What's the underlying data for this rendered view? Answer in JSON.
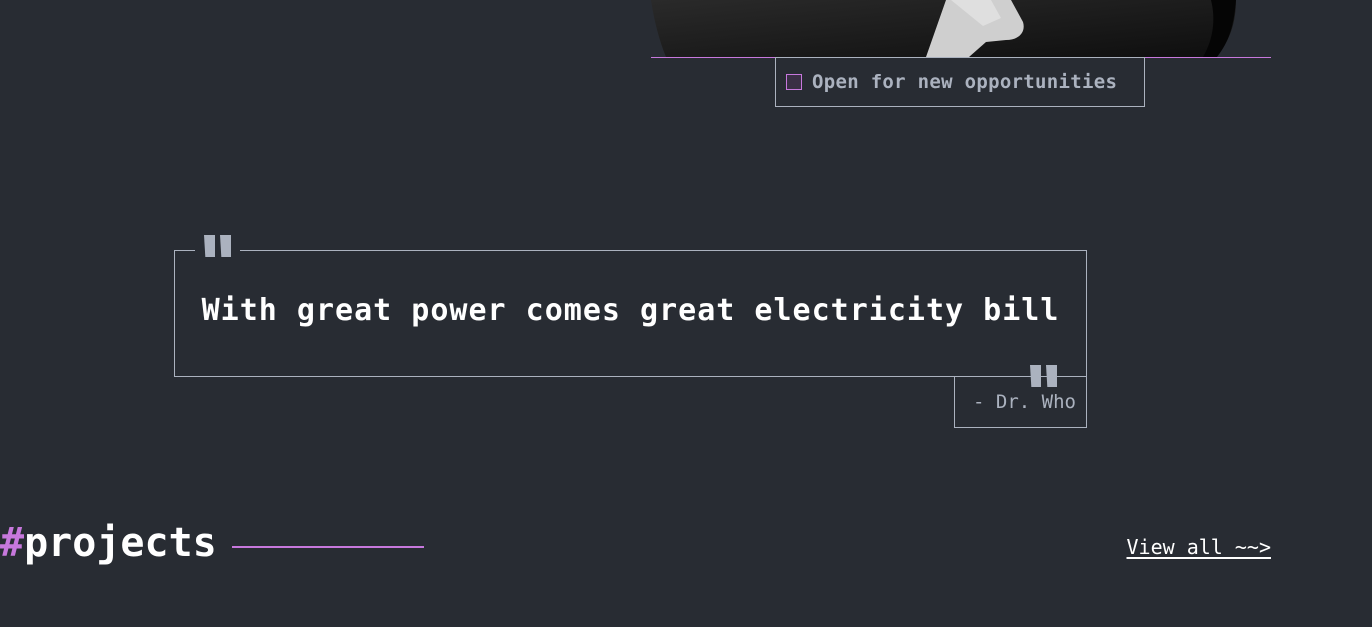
{
  "hero": {
    "status_text": "Open for new opportunities"
  },
  "quote": {
    "text": "With great power comes great electricity bill",
    "author": "- Dr. Who"
  },
  "projects": {
    "hash": "#",
    "title": "projects",
    "view_all": "View all ~~>"
  },
  "colors": {
    "background": "#282C33",
    "accent": "#C778DD",
    "text_gray": "#ABB2BF",
    "text_white": "#FFFFFF"
  }
}
